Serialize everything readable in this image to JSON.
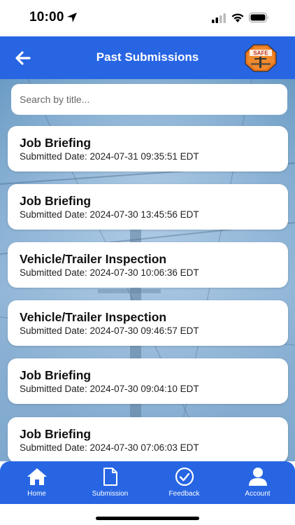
{
  "status_bar": {
    "time": "10:00"
  },
  "header": {
    "title": "Past Submissions",
    "logo_text": "SAFE"
  },
  "search": {
    "placeholder": "Search by title...",
    "value": ""
  },
  "submissions": [
    {
      "title": "Job Briefing",
      "date": "Submitted Date: 2024-07-31 09:35:51 EDT"
    },
    {
      "title": "Job Briefing",
      "date": "Submitted Date: 2024-07-30 13:45:56 EDT"
    },
    {
      "title": "Vehicle/Trailer Inspection",
      "date": "Submitted Date: 2024-07-30 10:06:36 EDT"
    },
    {
      "title": "Vehicle/Trailer Inspection",
      "date": "Submitted Date: 2024-07-30 09:46:57 EDT"
    },
    {
      "title": "Job Briefing",
      "date": "Submitted Date: 2024-07-30 09:04:10 EDT"
    },
    {
      "title": "Job Briefing",
      "date": "Submitted Date: 2024-07-30 07:06:03 EDT"
    }
  ],
  "tabs": [
    {
      "label": "Home",
      "icon": "home-icon"
    },
    {
      "label": "Submission",
      "icon": "document-icon"
    },
    {
      "label": "Feedback",
      "icon": "check-circle-icon"
    },
    {
      "label": "Account",
      "icon": "user-icon"
    }
  ],
  "colors": {
    "brand": "#2765e3",
    "card": "#ffffff"
  }
}
